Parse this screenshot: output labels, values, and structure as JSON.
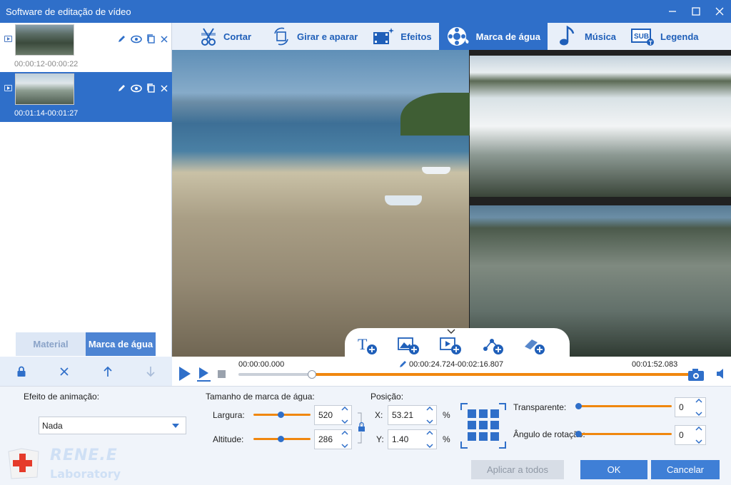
{
  "window": {
    "title": "Software de editação de vídeo"
  },
  "clips": [
    {
      "time": "00:00:12-00:00:22",
      "selected": false
    },
    {
      "time": "00:01:14-00:01:27",
      "selected": true
    }
  ],
  "left_tabs": {
    "material": "Material",
    "watermark": "Marca de água"
  },
  "toolbar": {
    "items": [
      {
        "label": "Cortar",
        "icon": "cut-icon"
      },
      {
        "label": "Girar e aparar",
        "icon": "rotate-crop-icon"
      },
      {
        "label": "Efeitos",
        "icon": "effects-icon"
      },
      {
        "label": "Marca de água",
        "icon": "watermark-icon",
        "active": true
      },
      {
        "label": "Música",
        "icon": "music-icon"
      },
      {
        "label": "Legenda",
        "icon": "subtitle-icon"
      }
    ]
  },
  "timeline": {
    "start": "00:00:00.000",
    "range": "00:00:24.724-00:02:16.807",
    "end": "00:01:52.083",
    "progress": 0.16
  },
  "settings": {
    "animation_label": "Efeito de animação:",
    "animation_value": "Nada",
    "size_label": "Tamanho de marca de água:",
    "width_label": "Largura:",
    "width_value": "520",
    "height_label": "Altitude:",
    "height_value": "286",
    "position_label": "Posição:",
    "x_label": "X:",
    "x_value": "53.21",
    "y_label": "Y:",
    "y_value": "1.40",
    "percent": "%",
    "transparent_label": "Transparente:",
    "transparent_value": "0",
    "rotation_label": "Ângulo de rotação:",
    "rotation_value": "0"
  },
  "buttons": {
    "apply_all": "Aplicar a todos",
    "ok": "OK",
    "cancel": "Cancelar"
  },
  "logo": {
    "brand": "RENE.E",
    "sub": "Laboratory"
  },
  "colors": {
    "accent": "#2f6fc9",
    "orange": "#f0870e"
  }
}
